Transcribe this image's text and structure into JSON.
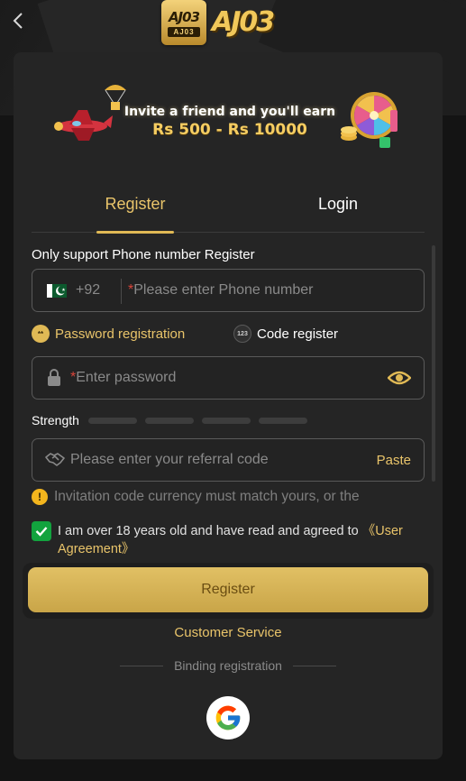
{
  "header": {
    "logo_badge_text": "AJ03",
    "logo_badge_sub": "AJ03",
    "logo_wordmark": "AJ03",
    "back_icon": "chevron-left-icon"
  },
  "banner": {
    "line1": "Invite a friend and you'll earn",
    "line2": "Rs 500 - Rs 10000"
  },
  "tabs": {
    "register": "Register",
    "login": "Login",
    "active": "register"
  },
  "form": {
    "support_label": "Only support Phone number Register",
    "phone": {
      "country_flag": "pakistan-flag-icon",
      "dial_code": "+92",
      "required_mark": "*",
      "placeholder": "Please enter Phone number"
    },
    "modes": {
      "password_label": "Password registration",
      "password_icon_text": "**",
      "code_label": "Code register",
      "code_icon_text": "123",
      "active": "password"
    },
    "password": {
      "required_mark": "*",
      "placeholder": "Enter password"
    },
    "strength": {
      "label": "Strength",
      "level": 0,
      "segments": 4
    },
    "referral": {
      "placeholder": "Please enter your referral code",
      "paste_label": "Paste"
    },
    "notice": "Invitation code currency must match yours, or the",
    "agreement": {
      "checked": true,
      "text": "I am over 18 years old and have read and agreed to ",
      "link": "《User Agreement》"
    },
    "submit_label": "Register"
  },
  "footer": {
    "customer_service": "Customer Service",
    "binding_label": "Binding registration",
    "google_icon": "google-icon"
  },
  "colors": {
    "accent_gold": "#e9c46a",
    "button_gold": "#d4b257",
    "card_bg": "#252525",
    "page_bg": "#141414",
    "checkbox_green": "#12a33e",
    "required_red": "#d9453a"
  }
}
